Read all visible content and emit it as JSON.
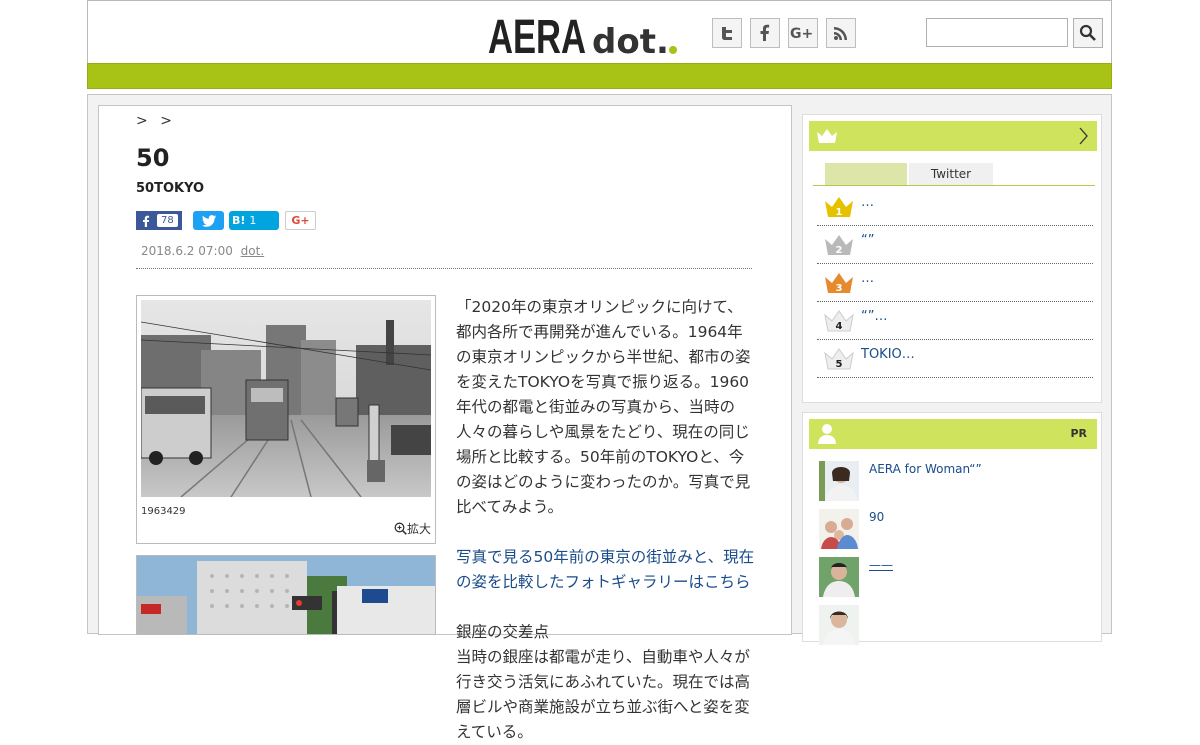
{
  "header": {
    "logo_main": "AERA",
    "logo_dot": "dot.",
    "social": [
      "twitter-icon",
      "facebook-icon",
      "google-plus-icon",
      "rss-icon"
    ],
    "search_value": ""
  },
  "colors": {
    "brand_green": "#a9c216",
    "panel_green": "#cfe35d",
    "link": "#1a4c8a"
  },
  "breadcrumb": [
    ">",
    ">"
  ],
  "article": {
    "title": "50",
    "subtitle": "50TOKYO",
    "share": {
      "facebook_count": "78",
      "hatena_label": "B!",
      "hatena_count": "1",
      "google_label": "G+"
    },
    "date": "2018.6.2 07:00",
    "source": "dot.",
    "photo_caption": "1963429",
    "enlarge_label": "拡大",
    "paragraph1": "「2020年の東京オリンピックに向けて、都内各所で再開発が進んでいる。1964年の東京オリンピックから半世紀、都市の姿を変えたTOKYOを写真で振り返る。1960年代の都電と街並みの写真から、当時の人々の暮らしや風景をたどり、現在の同じ場所と比較する。50年前のTOKYOと、今の姿はどのように変わったのか。写真で見比べてみよう。",
    "link_text": "写真で見る50年前の東京の街並みと、現在の姿を比較したフォトギャラリーはこちら",
    "paragraph2_head": "銀座の交差点",
    "paragraph2": "当時の銀座は都電が走り、自動車や人々が行き交う活気にあふれていた。現在では高層ビルや商業施設が立ち並ぶ街へと姿を変えている。"
  },
  "ranking": {
    "tabs": [
      "",
      "Twitter"
    ],
    "items": [
      {
        "num": "1",
        "text": "…"
      },
      {
        "num": "2",
        "text": "“”"
      },
      {
        "num": "3",
        "text": "…"
      },
      {
        "num": "4",
        "text": "“”…"
      },
      {
        "num": "5",
        "text": "TOKIO…"
      }
    ]
  },
  "pr": {
    "label": "PR",
    "items": [
      {
        "text": "AERA for Woman“”"
      },
      {
        "text": "90"
      },
      {
        "text": "——"
      },
      {
        "text": ""
      }
    ]
  }
}
